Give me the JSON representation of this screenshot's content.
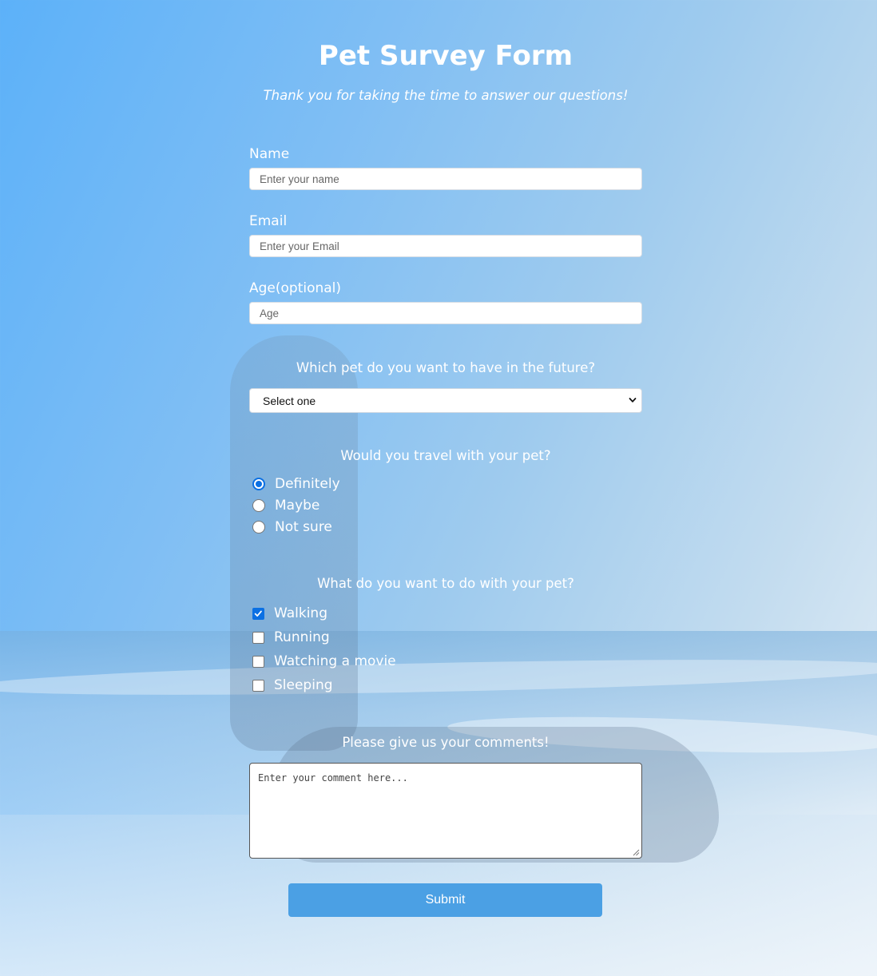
{
  "form": {
    "title": "Pet Survey Form",
    "description": "Thank you for taking the time to answer our questions!",
    "name": {
      "label": "Name",
      "placeholder": "Enter your name"
    },
    "email": {
      "label": "Email",
      "placeholder": "Enter your Email"
    },
    "age": {
      "label": "Age(optional)",
      "placeholder": "Age"
    },
    "pet_select": {
      "question": "Which pet do you want to have in the future?",
      "selected": "Select one"
    },
    "travel": {
      "question": "Would you travel with your pet?",
      "options": [
        {
          "label": "Definitely",
          "checked": true
        },
        {
          "label": "Maybe",
          "checked": false
        },
        {
          "label": "Not sure",
          "checked": false
        }
      ]
    },
    "activities": {
      "question": "What do you want to do with your pet?",
      "options": [
        {
          "label": "Walking",
          "checked": true
        },
        {
          "label": "Running",
          "checked": false
        },
        {
          "label": "Watching a movie",
          "checked": false
        },
        {
          "label": "Sleeping",
          "checked": false
        }
      ]
    },
    "comments": {
      "question": "Please give us your comments!",
      "placeholder": "Enter your comment here..."
    },
    "submit_label": "Submit"
  },
  "colors": {
    "accent": "#0b70e3",
    "submit_bg": "#4ba0e4",
    "text": "#ffffff"
  },
  "icons": {
    "select_chevron": "chevron-down-icon",
    "textarea_resize": "resize-handle-icon",
    "checkbox_tick": "checkmark-icon"
  }
}
